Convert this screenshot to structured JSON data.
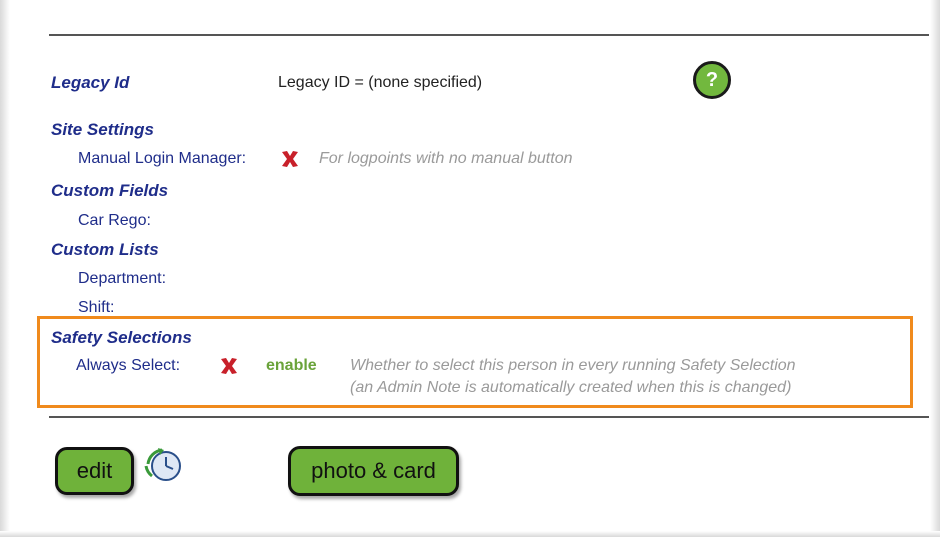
{
  "legacy": {
    "heading": "Legacy Id",
    "value": "Legacy ID = (none specified)",
    "help_glyph": "?"
  },
  "site_settings": {
    "heading": "Site Settings",
    "manual_login_label": "Manual Login Manager:",
    "manual_login_value_icon": "red-x-icon",
    "manual_login_hint": "For logpoints with no manual button"
  },
  "custom_fields": {
    "heading": "Custom Fields",
    "items": [
      {
        "label": "Car Rego:"
      }
    ]
  },
  "custom_lists": {
    "heading": "Custom Lists",
    "items": [
      {
        "label": "Department:"
      },
      {
        "label": "Shift:"
      }
    ]
  },
  "safety_selections": {
    "heading": "Safety Selections",
    "always_select_label": "Always Select:",
    "always_select_value_icon": "red-x-icon",
    "enable_link": "enable",
    "hint_line1": "Whether to select this person in every running Safety Selection",
    "hint_line2": "(an Admin Note is automatically created when this is changed)"
  },
  "buttons": {
    "edit_label": "edit",
    "photo_card_label": "photo & card"
  },
  "colors": {
    "heading_blue": "#1f2d8a",
    "button_green": "#6fb23a",
    "enable_green": "#6aa33a",
    "highlight_orange": "#f08a1c",
    "x_red": "#c8202a"
  }
}
